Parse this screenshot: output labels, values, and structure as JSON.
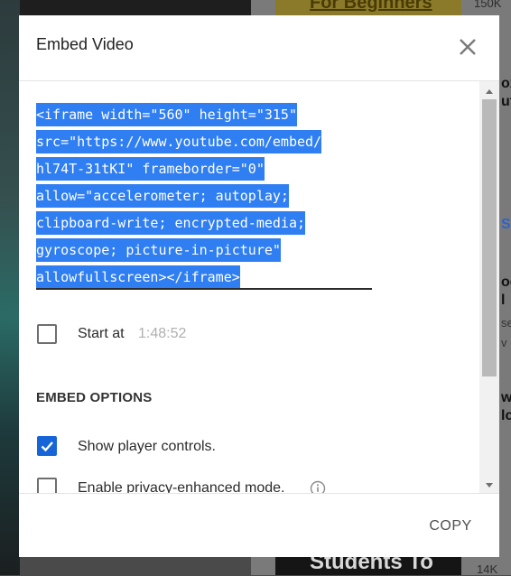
{
  "background": {
    "top_title": "For Beginners",
    "top_count": "150K",
    "bottom_title": "Students To",
    "bottom_count": "14K",
    "side_letters": [
      "ox",
      "ut",
      "SH",
      "oc",
      "l",
      "se",
      "v",
      "w",
      "lc"
    ]
  },
  "dialog": {
    "title": "Embed Video",
    "close_icon": "close-icon",
    "embed_code_lines": [
      "<iframe width=\"560\" height=\"315\"",
      "src=\"https://www.youtube.com/embed/",
      "hl74T-31tKI\" frameborder=\"0\"",
      "allow=\"accelerometer; autoplay;",
      "clipboard-write; encrypted-media;",
      "gyroscope; picture-in-picture\"",
      "allowfullscreen></iframe>"
    ],
    "start_at": {
      "label": "Start at",
      "time": "1:48:52",
      "checked": false
    },
    "embed_options": {
      "heading": "EMBED OPTIONS",
      "options": [
        {
          "label": "Show player controls.",
          "checked": true
        },
        {
          "label": "Enable privacy-enhanced mode.",
          "checked": false,
          "icon": "info-icon"
        }
      ]
    },
    "copy_label": "COPY"
  },
  "colors": {
    "selection": "#2f7ef2",
    "checkbox_checked": "#1565d8",
    "scroll_thumb": "#b9b9b9"
  }
}
